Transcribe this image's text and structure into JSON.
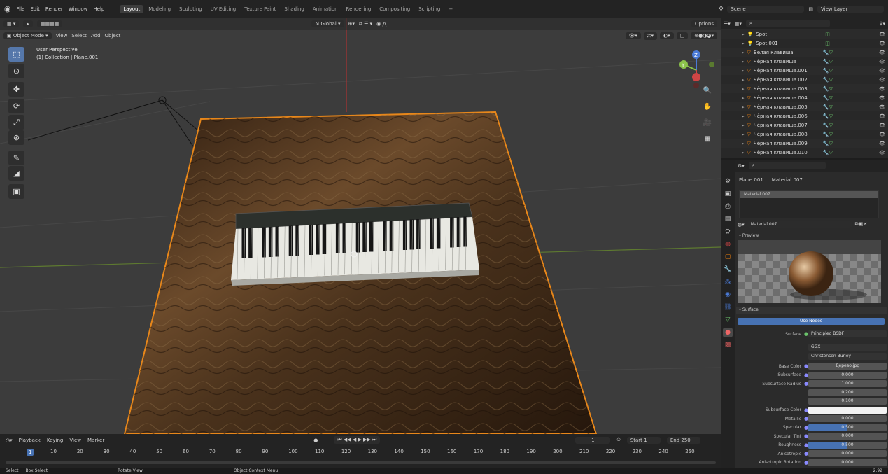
{
  "topbar": {
    "menus": [
      "File",
      "Edit",
      "Render",
      "Window",
      "Help"
    ],
    "workspaces": [
      "Layout",
      "Modeling",
      "Sculpting",
      "UV Editing",
      "Texture Paint",
      "Shading",
      "Animation",
      "Rendering",
      "Compositing",
      "Scripting"
    ],
    "active_workspace": "Layout",
    "scene": "Scene",
    "view_layer": "View Layer"
  },
  "viewport": {
    "mode": "Object Mode",
    "menus": [
      "View",
      "Select",
      "Add",
      "Object"
    ],
    "orientation": "Global",
    "options": "Options",
    "overlay_title": "User Perspective",
    "overlay_subtitle": "(1) Collection | Plane.001",
    "gizmo": {
      "x": "X",
      "y": "Y",
      "z": "Z"
    }
  },
  "timeline": {
    "menus": [
      "Playback",
      "Keying",
      "View",
      "Marker"
    ],
    "current_frame": "1",
    "start_label": "Start",
    "start": "1",
    "end_label": "End",
    "end": "250",
    "ticks": [
      "1",
      "10",
      "20",
      "30",
      "40",
      "50",
      "60",
      "70",
      "80",
      "90",
      "100",
      "110",
      "120",
      "130",
      "140",
      "150",
      "160",
      "170",
      "180",
      "190",
      "200",
      "210",
      "220",
      "230",
      "240",
      "250"
    ]
  },
  "statusbar": {
    "items": [
      "Select",
      "Box Select",
      "Rotate View",
      "Object Context Menu"
    ],
    "version": "2.92"
  },
  "outliner": {
    "items": [
      {
        "name": "Spot",
        "type": "light"
      },
      {
        "name": "Spot.001",
        "type": "light"
      },
      {
        "name": "Белая клавиша",
        "type": "mesh"
      },
      {
        "name": "Чёрная клавиша",
        "type": "mesh"
      },
      {
        "name": "Чёрная клавиша.001",
        "type": "mesh"
      },
      {
        "name": "Чёрная клавиша.002",
        "type": "mesh"
      },
      {
        "name": "Чёрная клавиша.003",
        "type": "mesh"
      },
      {
        "name": "Чёрная клавиша.004",
        "type": "mesh"
      },
      {
        "name": "Чёрная клавиша.005",
        "type": "mesh"
      },
      {
        "name": "Чёрная клавиша.006",
        "type": "mesh"
      },
      {
        "name": "Чёрная клавиша.007",
        "type": "mesh"
      },
      {
        "name": "Чёрная клавиша.008",
        "type": "mesh"
      },
      {
        "name": "Чёрная клавиша.009",
        "type": "mesh"
      },
      {
        "name": "Чёрная клавиша.010",
        "type": "mesh"
      }
    ]
  },
  "properties": {
    "breadcrumb_object": "Plane.001",
    "breadcrumb_material": "Material.007",
    "slot": "Material.007",
    "material_name": "Material.007",
    "preview_label": "Preview",
    "surface_label": "Surface",
    "use_nodes": "Use Nodes",
    "surface_shader_label": "Surface",
    "surface_shader": "Principled BSDF",
    "distribution": "GGX",
    "subsurface_method": "Christensen-Burley",
    "rows": [
      {
        "label": "Base Color",
        "value": "Дерево.jpg",
        "fill": 0
      },
      {
        "label": "Subsurface",
        "value": "0.000",
        "fill": 0
      },
      {
        "label": "Subsurface Radius",
        "value": "1.000",
        "fill": 0
      },
      {
        "label": "",
        "value": "0.200",
        "fill": 0
      },
      {
        "label": "",
        "value": "0.100",
        "fill": 0
      },
      {
        "label": "Subsurface Color",
        "value": "",
        "fill": 0,
        "swatch": "#f2f2f2"
      },
      {
        "label": "Metallic",
        "value": "0.000",
        "fill": 0
      },
      {
        "label": "Specular",
        "value": "0.500",
        "fill": 0.5
      },
      {
        "label": "Specular Tint",
        "value": "0.000",
        "fill": 0
      },
      {
        "label": "Roughness",
        "value": "0.500",
        "fill": 0.5
      },
      {
        "label": "Anisotropic",
        "value": "0.000",
        "fill": 0
      },
      {
        "label": "Anisotropic Rotation",
        "value": "0.000",
        "fill": 0
      }
    ]
  },
  "colors": {
    "accent": "#4772b3",
    "selection": "#e8871a",
    "mesh_icon": "#e87d0d",
    "green_axis": "#6a9a2a",
    "red_axis": "#a33"
  }
}
